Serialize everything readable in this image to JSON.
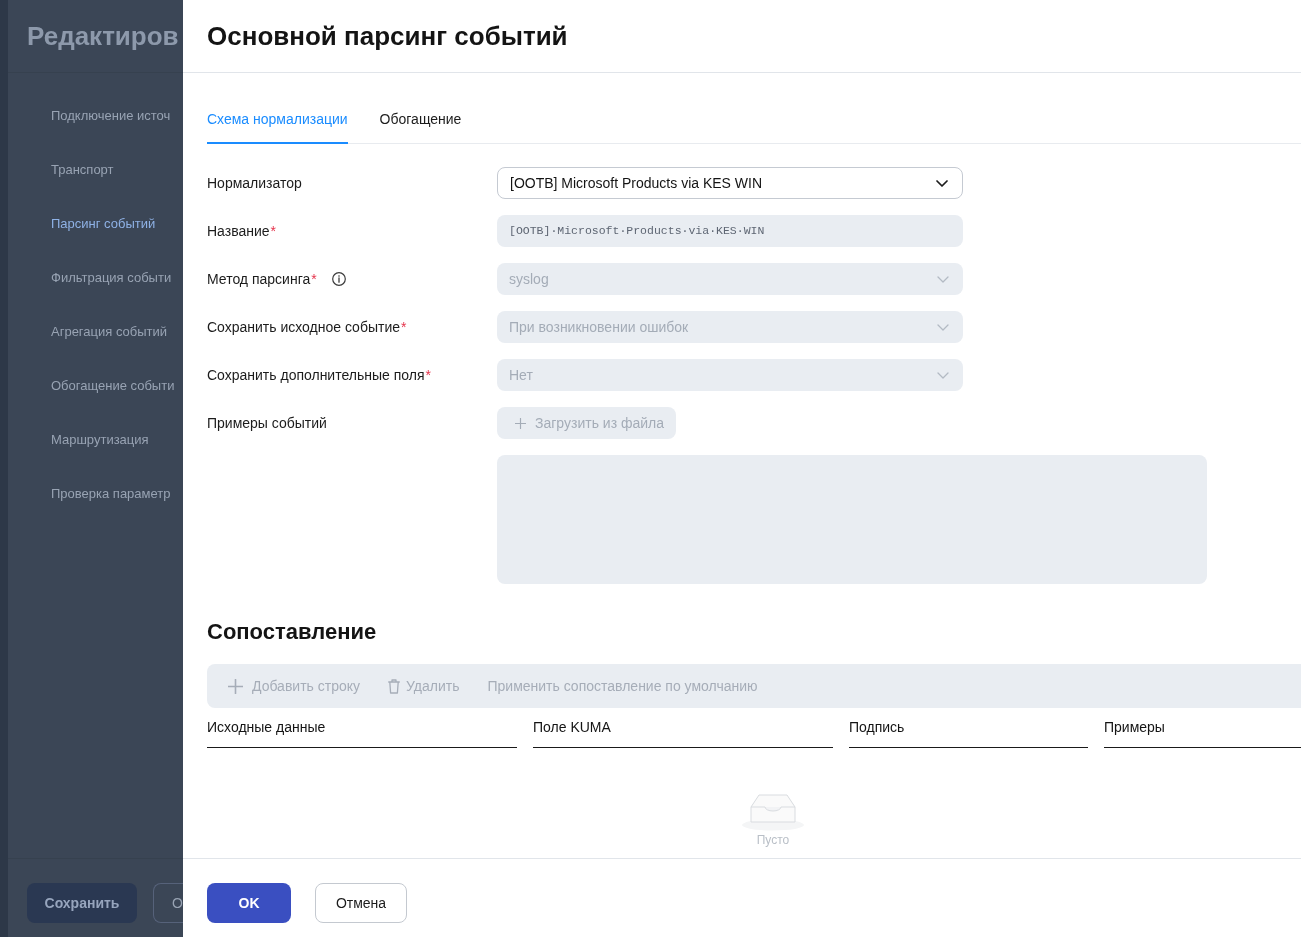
{
  "background_page": {
    "title": "Редактиров",
    "nav_items": [
      {
        "label": "Подключение источ",
        "selected": false
      },
      {
        "label": "Транспорт",
        "selected": false
      },
      {
        "label": "Парсинг событий",
        "selected": true
      },
      {
        "label": "Фильтрация событи",
        "selected": false
      },
      {
        "label": "Агрегация событий",
        "selected": false
      },
      {
        "label": "Обогащение событи",
        "selected": false
      },
      {
        "label": "Маршрутизация",
        "selected": false
      },
      {
        "label": "Проверка параметр",
        "selected": false
      }
    ],
    "buttons": [
      {
        "label": "Сохранить",
        "kind": "primary"
      },
      {
        "label": "О",
        "kind": "secondary"
      }
    ]
  },
  "drawer_title": "Основной парсинг событий",
  "tabs": [
    {
      "label": "Схема нормализации",
      "selected": true
    },
    {
      "label": "Обогащение",
      "selected": false
    }
  ],
  "form": [
    {
      "kind": "select",
      "label": "Нормализатор",
      "info": false,
      "value": "[OOTB] Microsoft Products via KES WIN",
      "disabled": false
    },
    {
      "kind": "text",
      "label": "Название",
      "required_mark": "*",
      "info": false,
      "value": "[OOTB]·Microsoft·Products·via·KES·WIN",
      "disabled": true
    },
    {
      "kind": "select",
      "label": "Метод парсинга",
      "required_mark": "*",
      "info": true,
      "value": "syslog",
      "disabled": true
    },
    {
      "kind": "select",
      "label": "Сохранить исходное событие",
      "required_mark": "*",
      "info": false,
      "value": "При возникновении ошибок",
      "disabled": true
    },
    {
      "kind": "select",
      "label": "Сохранить дополнительные поля",
      "required_mark": "*",
      "info": false,
      "value": "Нет",
      "disabled": true
    },
    {
      "kind": "upload",
      "label": "Примеры событий",
      "info": false,
      "button": "Загрузить из файла",
      "disabled": true
    }
  ],
  "mapping": {
    "title": "Сопоставление",
    "toolbar": [
      {
        "kind": "add",
        "label": "Добавить строку",
        "disabled": true
      },
      {
        "kind": "delete",
        "label": "Удалить",
        "disabled": true
      },
      {
        "kind": "apply",
        "label": "Применить сопоставление по умолчанию",
        "disabled": true
      }
    ],
    "columns": [
      "Исходные данные",
      "Поле KUMA",
      "Подпись",
      "Примеры"
    ],
    "empty_text": "Пусто"
  },
  "footer_buttons": [
    {
      "label": "OK",
      "kind": "primary"
    },
    {
      "label": "Отмена",
      "kind": "secondary"
    }
  ]
}
